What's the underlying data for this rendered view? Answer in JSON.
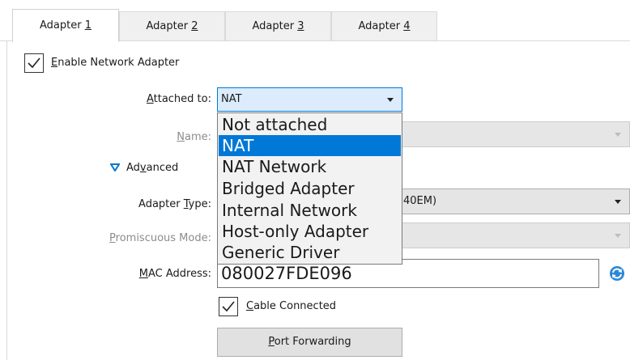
{
  "tabs": [
    {
      "prefix": "Adapter ",
      "key": "1",
      "active": true
    },
    {
      "prefix": "Adapter ",
      "key": "2",
      "active": false
    },
    {
      "prefix": "Adapter ",
      "key": "3",
      "active": false
    },
    {
      "prefix": "Adapter ",
      "key": "4",
      "active": false
    }
  ],
  "enable_adapter": {
    "key": "E",
    "rest": "nable Network Adapter",
    "checked": true
  },
  "attached_to": {
    "label_key": "A",
    "label_rest": "ttached to:",
    "value": "NAT",
    "options": [
      "Not attached",
      "NAT",
      "NAT Network",
      "Bridged Adapter",
      "Internal Network",
      "Host-only Adapter",
      "Generic Driver"
    ],
    "selected_index": 1
  },
  "name": {
    "label_key": "N",
    "label_rest": "ame:"
  },
  "advanced": {
    "pre": "Ad",
    "key": "v",
    "rest": "anced"
  },
  "adapter_type": {
    "label_pre": "Adapter ",
    "label_key": "T",
    "label_rest": "ype:",
    "value_visible": "40EM)"
  },
  "promiscuous": {
    "label_key": "P",
    "label_rest": "romiscuous Mode:"
  },
  "mac": {
    "label_pre": "",
    "label_key": "M",
    "label_rest": "AC Address:",
    "value": "080027FDE096"
  },
  "cable": {
    "key": "C",
    "rest": "able Connected",
    "checked": true
  },
  "port_forwarding": {
    "key": "P",
    "rest": "ort Forwarding"
  },
  "colors": {
    "accent": "#0078d7",
    "refresh": "#2b88d8"
  }
}
